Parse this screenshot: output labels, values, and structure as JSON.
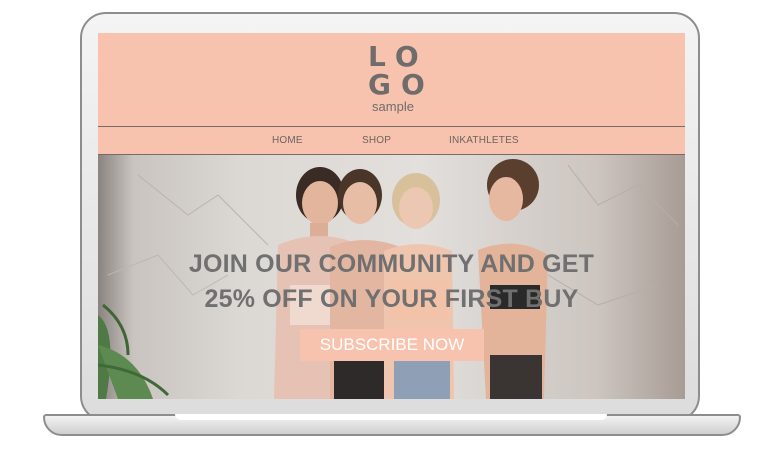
{
  "header": {
    "logo_line1": "LO",
    "logo_line2": "GO",
    "logo_tagline": "sample"
  },
  "nav": {
    "items": [
      {
        "label": "HOME"
      },
      {
        "label": "SHOP"
      },
      {
        "label": "INKATHLETES"
      }
    ]
  },
  "hero": {
    "headline_line1": "JOIN OUR COMMUNITY AND GET",
    "headline_line2": "25% OFF ON YOUR FIRST BUY",
    "cta_label": "SUBSCRIBE NOW"
  },
  "colors": {
    "brand_peach": "#f8c3ae",
    "text_gray": "#707070"
  }
}
